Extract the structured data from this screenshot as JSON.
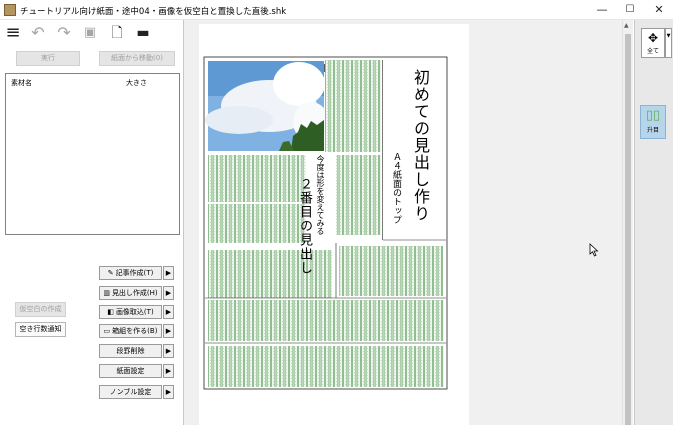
{
  "window": {
    "title": "チュートリアル向け紙面・途中04・画像を仮空白と置換した直後.shk",
    "minimize": "—",
    "maximize": "☐",
    "close": "✕"
  },
  "toolbar": {
    "menu_icon": "≡",
    "undo_icon": "↶",
    "redo_icon": "↷",
    "save_icon": "▣",
    "new_file_icon": "🗋",
    "open_icon": "▬"
  },
  "buttons": {
    "run": "実行",
    "restore": "紙面から移動(0)",
    "temp_blank": "仮空白の作成",
    "blank_lines": "空き行数通知"
  },
  "material_list": {
    "col_name": "素材名",
    "col_size": "大きさ"
  },
  "actions": [
    {
      "icon": "✎",
      "label": "記事作成(T)",
      "arrow": "▶"
    },
    {
      "icon": "▥",
      "label": "見出し作成(H)",
      "arrow": "▶"
    },
    {
      "icon": "◧",
      "label": "画像取込(T)",
      "arrow": "▶"
    },
    {
      "icon": "▭",
      "label": "箱組を作る(B)",
      "arrow": "▶"
    },
    {
      "icon": "",
      "label": "段罫削除",
      "arrow": "▶"
    },
    {
      "icon": "",
      "label": "紙面設定",
      "arrow": "▶"
    },
    {
      "icon": "",
      "label": "ノンブル設定",
      "arrow": "▶"
    }
  ],
  "newspaper": {
    "headline1": "初めての見出し作り",
    "headline1_sub": "Ａ４紙面のトップ",
    "headline2": "２番目の見出し",
    "headline2_sub": "今度は形を変えてみる"
  },
  "scrollbar": {
    "up": "▲",
    "down": "▼"
  },
  "right_panel": {
    "zoom_icon": "✥",
    "zoom_label": "全て",
    "zoom_dropdown": "▼",
    "column_icon": "▯▯",
    "column_label": "升目"
  },
  "colors": {
    "canvas_bg": "#f0f0f0",
    "grid_green": "#3a8a3a",
    "selected_blue": "#b7d5ea"
  }
}
